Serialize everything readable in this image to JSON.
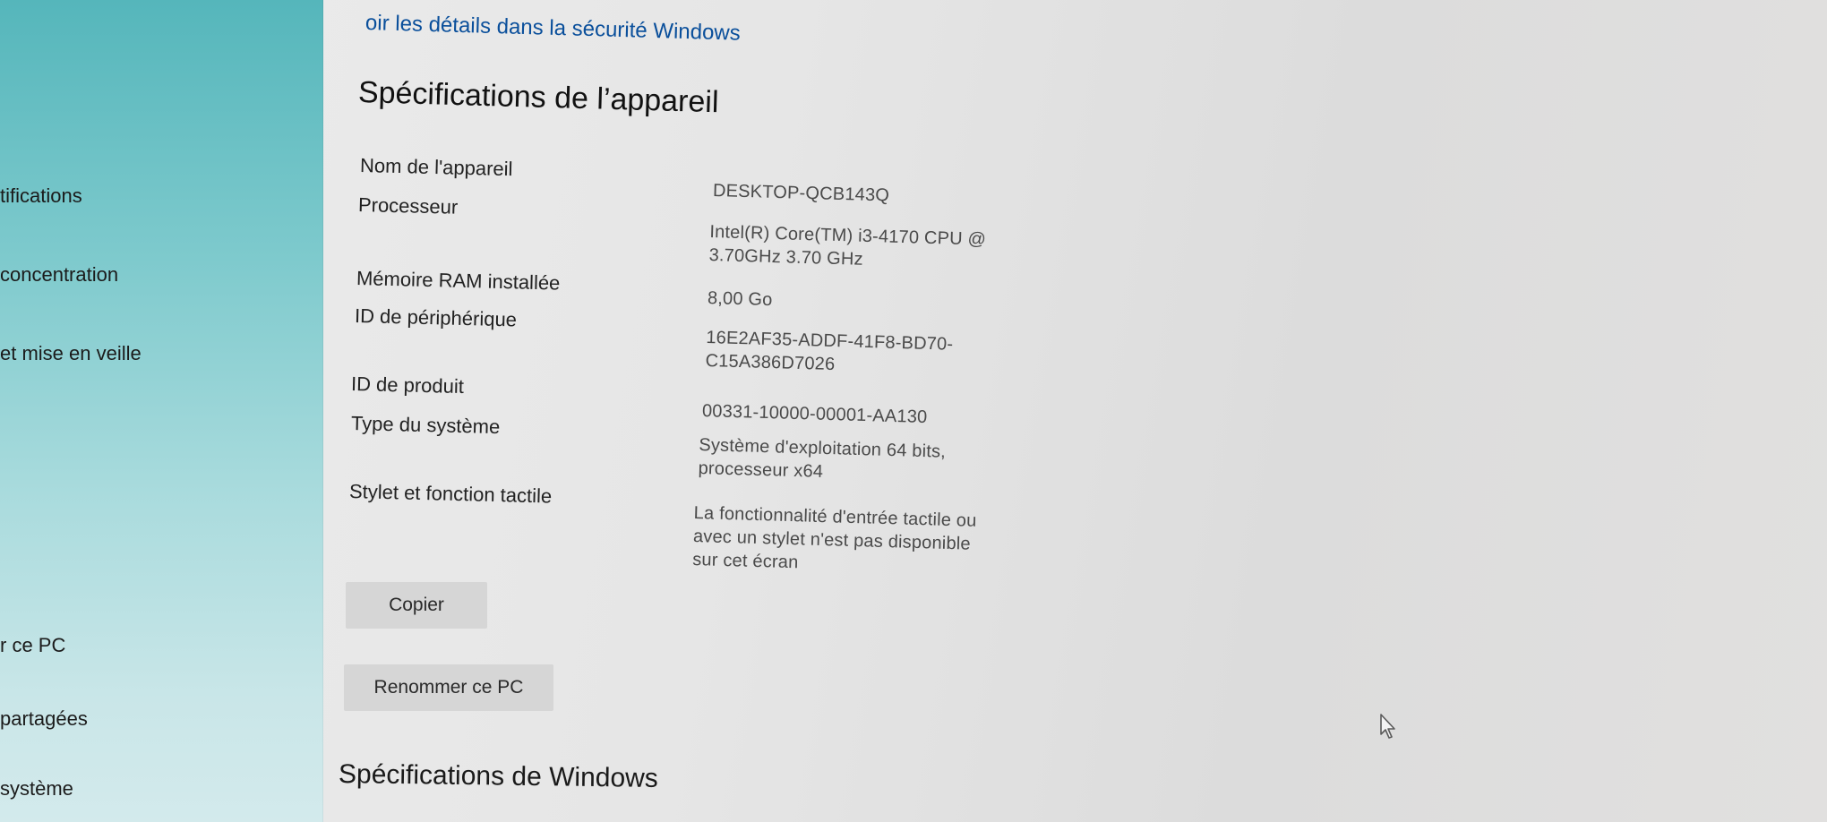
{
  "sidebar": {
    "items": [
      {
        "label": "tifications"
      },
      {
        "label": "concentration"
      },
      {
        "label": " et mise en veille"
      },
      {
        "label": "r ce PC"
      },
      {
        "label": "partagées"
      },
      {
        "label": " système"
      }
    ]
  },
  "header": {
    "link": "oir les détails dans la sécurité Windows",
    "title": "Spécifications de l’appareil"
  },
  "specs": {
    "device_name": {
      "label": "Nom de l'appareil",
      "value": "DESKTOP-QCB143Q"
    },
    "processor": {
      "label": "Processeur",
      "value": "Intel(R) Core(TM) i3-4170 CPU @\n3.70GHz   3.70 GHz"
    },
    "ram": {
      "label": "Mémoire RAM installée",
      "value": "8,00 Go"
    },
    "device_id": {
      "label": "ID de périphérique",
      "value": "16E2AF35-ADDF-41F8-BD70-\nC15A386D7026"
    },
    "product_id": {
      "label": "ID de produit",
      "value": "00331-10000-00001-AA130"
    },
    "system_type": {
      "label": "Type du système",
      "value": "Système d'exploitation 64 bits,\nprocesseur x64"
    },
    "pen_touch": {
      "label": "Stylet et fonction tactile",
      "value": "La fonctionnalité d'entrée tactile ou\navec un stylet n'est pas disponible\nsur cet écran"
    }
  },
  "buttons": {
    "copy": "Copier",
    "rename": "Renommer ce PC"
  },
  "windows_section": {
    "title": "Spécifications de Windows"
  },
  "icons": {
    "cursor": "mouse-pointer-icon"
  }
}
